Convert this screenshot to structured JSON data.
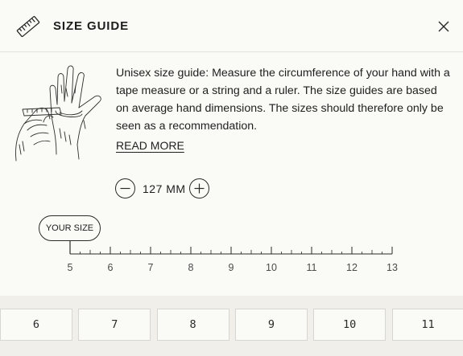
{
  "header": {
    "title": "SIZE GUIDE",
    "icon": "ruler-icon",
    "close_icon": "close-icon"
  },
  "guide": {
    "illustration": "hands-measuring-illustration",
    "description": "Unisex size guide: Measure the circumference of your hand with a tape measure or a string and a ruler. The size guides are based on average hand dimensions. The sizes should therefore only be seen as a recommendation.",
    "read_more": "READ MORE"
  },
  "stepper": {
    "value": "127 MM",
    "minus_icon": "minus-circle-icon",
    "plus_icon": "plus-circle-icon"
  },
  "indicator": {
    "label": "YOUR SIZE",
    "value": 5
  },
  "scale": {
    "ticks": [
      "5",
      "6",
      "7",
      "8",
      "9",
      "10",
      "11",
      "12",
      "13"
    ],
    "min": 5,
    "max": 13
  },
  "size_buttons": [
    "6",
    "7",
    "8",
    "9",
    "10",
    "11"
  ],
  "colors": {
    "panel": "#fafaf6",
    "background": "#f0efe9",
    "text": "#1d1d1d",
    "border": "#d7d6d0"
  }
}
